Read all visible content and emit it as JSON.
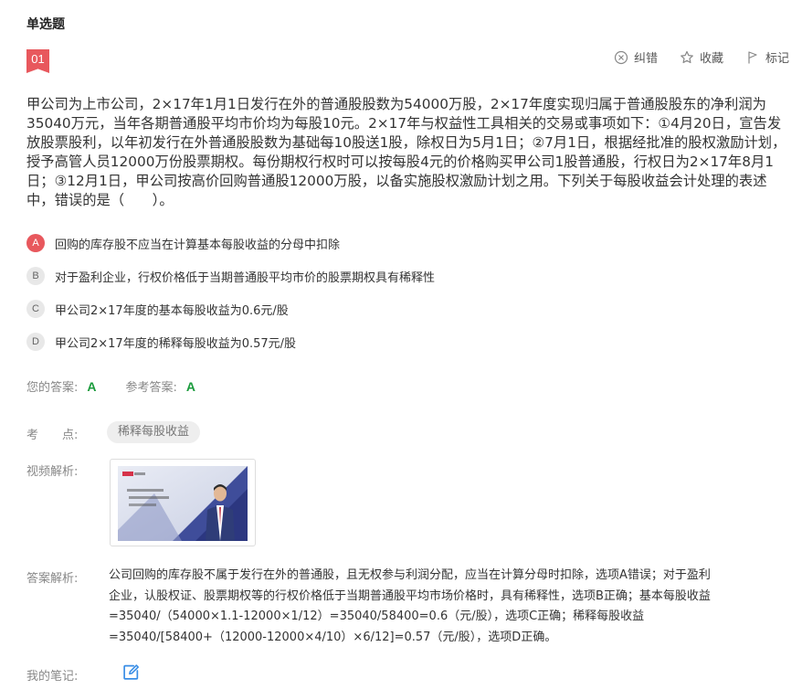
{
  "section_title": "单选题",
  "question_number": "01",
  "actions": [
    {
      "label": "纠错",
      "icon": "error-report-icon"
    },
    {
      "label": "收藏",
      "icon": "star-icon"
    },
    {
      "label": "标记",
      "icon": "flag-icon"
    }
  ],
  "stem": "甲公司为上市公司，2×17年1月1日发行在外的普通股股数为54000万股，2×17年度实现归属于普通股股东的净利润为35040万元，当年各期普通股平均市价均为每股10元。2×17年与权益性工具相关的交易或事项如下：①4月20日，宣告发放股票股利，以年初发行在外普通股股数为基础每10股送1股，除权日为5月1日；②7月1日，根据经批准的股权激励计划，授予高管人员12000万份股票期权。每份期权行权时可以按每股4元的价格购买甲公司1股普通股，行权日为2×17年8月1日；③12月1日，甲公司按高价回购普通股12000万股，以备实施股权激励计划之用。下列关于每股收益会计处理的表述中，错误的是（　　）。",
  "options": [
    {
      "letter": "A",
      "text": "回购的库存股不应当在计算基本每股收益的分母中扣除",
      "selected": true
    },
    {
      "letter": "B",
      "text": "对于盈利企业，行权价格低于当期普通股平均市价的股票期权具有稀释性",
      "selected": false
    },
    {
      "letter": "C",
      "text": "甲公司2×17年度的基本每股收益为0.6元/股",
      "selected": false
    },
    {
      "letter": "D",
      "text": "甲公司2×17年度的稀释每股收益为0.57元/股",
      "selected": false
    }
  ],
  "your_answer_label": "您的答案:",
  "your_answer": "A",
  "reference_answer_label": "参考答案:",
  "reference_answer": "A",
  "point_label": "考　　点:",
  "point_tag": "稀释每股收益",
  "video_label": "视频解析:",
  "analysis_label": "答案解析:",
  "analysis_text": "公司回购的库存股不属于发行在外的普通股，且无权参与利润分配，应当在计算分母时扣除，选项A错误；对于盈利企业，认股权证、股票期权等的行权价格低于当期普通股平均市场价格时，具有稀释性，选项B正确；基本每股收益=35040/（54000×1.1-12000×1/12）=35040/58400=0.6（元/股），选项C正确；稀释每股收益=35040/[58400+（12000-12000×4/10）×6/12]=0.57（元/股），选项D正确。",
  "notes_label": "我的笔记:",
  "colors": {
    "accent": "#e8585d",
    "correct": "#1a9b3c",
    "note_icon": "#3a8ee6"
  }
}
